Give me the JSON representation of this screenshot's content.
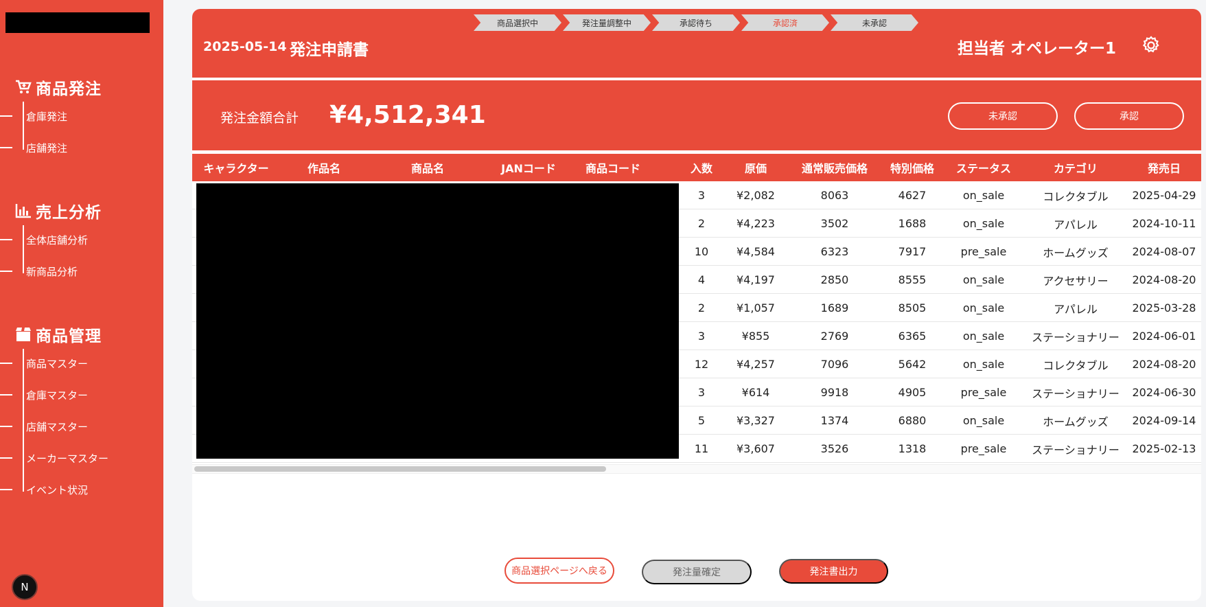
{
  "sidebar": {
    "sections": [
      {
        "label": "商品発注",
        "icon": "cart-icon",
        "items": [
          "倉庫発注",
          "店舗発注"
        ]
      },
      {
        "label": "売上分析",
        "icon": "bar-chart-icon",
        "items": [
          "全体店舗分析",
          "新商品分析"
        ]
      },
      {
        "label": "商品管理",
        "icon": "box-icon",
        "items": [
          "商品マスター",
          "倉庫マスター",
          "店舗マスター",
          "メーカーマスター",
          "イベント状況"
        ]
      }
    ],
    "avatar_letter": "N"
  },
  "steps": [
    "商品選択中",
    "発注量調整中",
    "承認待ち",
    "承認済",
    "未承認"
  ],
  "active_step": "承認済",
  "header": {
    "date": "2025-05-14",
    "title": "発注申請書",
    "operator": "担当者 オペレーター1"
  },
  "summary": {
    "label": "発注金額合計",
    "total": "¥4,512,341",
    "unapprove_label": "未承認",
    "approve_label": "承認"
  },
  "table": {
    "columns": [
      "キャラクター",
      "作品名",
      "商品名",
      "JANコード",
      "商品コード",
      "入数",
      "原価",
      "通常販売価格",
      "特別価格",
      "ステータス",
      "カテゴリ",
      "発売日"
    ],
    "rows": [
      [
        "3",
        "¥2,082",
        "8063",
        "4627",
        "on_sale",
        "コレクタブル",
        "2025-04-29"
      ],
      [
        "2",
        "¥4,223",
        "3502",
        "1688",
        "on_sale",
        "アパレル",
        "2024-10-11"
      ],
      [
        "10",
        "¥4,584",
        "6323",
        "7917",
        "pre_sale",
        "ホームグッズ",
        "2024-08-07"
      ],
      [
        "4",
        "¥4,197",
        "2850",
        "8555",
        "on_sale",
        "アクセサリー",
        "2024-08-20"
      ],
      [
        "2",
        "¥1,057",
        "1689",
        "8505",
        "on_sale",
        "アパレル",
        "2025-03-28"
      ],
      [
        "3",
        "¥855",
        "2769",
        "6365",
        "on_sale",
        "ステーショナリー",
        "2024-06-01"
      ],
      [
        "12",
        "¥4,257",
        "7096",
        "5642",
        "on_sale",
        "コレクタブル",
        "2024-08-20"
      ],
      [
        "3",
        "¥614",
        "9918",
        "4905",
        "pre_sale",
        "ステーショナリー",
        "2024-06-30"
      ],
      [
        "5",
        "¥3,327",
        "1374",
        "6880",
        "on_sale",
        "ホームグッズ",
        "2024-09-14"
      ],
      [
        "11",
        "¥3,607",
        "3526",
        "1318",
        "pre_sale",
        "ステーショナリー",
        "2025-02-13"
      ]
    ]
  },
  "footer": {
    "back_label": "商品選択ページへ戻る",
    "confirm_label": "発注量確定",
    "export_label": "発注書出力"
  },
  "colors": {
    "accent": "#e84b3a",
    "disabled": "#d9d9d9"
  }
}
